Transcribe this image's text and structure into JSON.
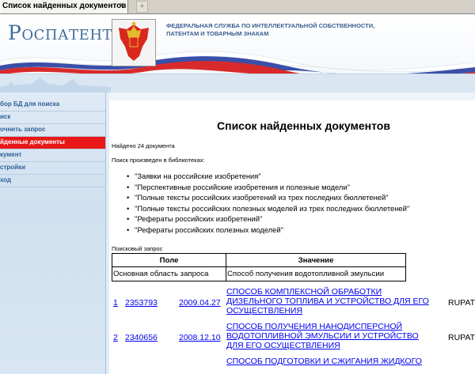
{
  "tab": {
    "label": "Список найденных документов",
    "close": "×",
    "new": "+"
  },
  "header": {
    "logo": "Роспатент",
    "agency_line1": "ФЕДЕРАЛЬНАЯ СЛУЖБА ПО ИНТЕЛЛЕКТУАЛЬНОЙ СОБСТВЕННОСТИ,",
    "agency_line2": "ПАТЕНТАМ И ТОВАРНЫМ ЗНАКАМ"
  },
  "sidebar": {
    "items": [
      {
        "label": "бор БД для поиска",
        "active": false
      },
      {
        "label": "иск",
        "active": false
      },
      {
        "label": "очнить запрос",
        "active": false
      },
      {
        "label": "йденные документы",
        "active": true
      },
      {
        "label": "кумент",
        "active": false
      },
      {
        "label": "стройки",
        "active": false
      },
      {
        "label": "ход",
        "active": false
      }
    ]
  },
  "main": {
    "title": "Список найденных документов",
    "found": "Найдено 24 документа",
    "libraries_caption": "Поиск произведен в библиотеках:",
    "libraries": [
      "\"Заявки на российские изобретения\"",
      "\"Перспективные российские изобретения и полезные модели\"",
      "\"Полные тексты российских изобретений из трех последних бюллетеней\"",
      "\"Полные тексты российских полезных моделей из трех последних бюллетеней\"",
      "\"Рефераты российских изобретений\"",
      "\"Рефераты российских полезных моделей\""
    ],
    "query_caption": "Поисковый запрос",
    "query_table": {
      "headers": [
        "Поле",
        "Значение"
      ],
      "rows": [
        [
          "Основная область запроса",
          "Способ получения водотопливной эмульсии"
        ]
      ]
    },
    "results": [
      {
        "num": "1",
        "id": "2353793",
        "date": "2009.04.27",
        "title": "СПОСОБ КОМПЛЕКСНОЙ ОБРАБОТКИ ДИЗЕЛЬНОГО ТОПЛИВА И УСТРОЙСТВО ДЛЯ ЕГО ОСУЩЕСТВЛЕНИЯ",
        "source": "RUPAT"
      },
      {
        "num": "2",
        "id": "2340656",
        "date": "2008.12.10",
        "title": "СПОСОБ ПОЛУЧЕНИЯ НАНОДИСПЕРСНОЙ ВОДОТОПЛИВНОЙ ЭМУЛЬСИИ И УСТРОЙСТВО ДЛЯ ЕГО ОСУЩЕСТВЛЕНИЯ",
        "source": "RUPAT"
      },
      {
        "num": "",
        "id": "",
        "date": "",
        "title": "СПОСОБ ПОДГОТОВКИ И СЖИГАНИЯ ЖИДКОГО",
        "source": ""
      }
    ]
  },
  "colors": {
    "active_menu": "#e81818",
    "link": "#0000ee",
    "brand": "#3f6d99"
  }
}
